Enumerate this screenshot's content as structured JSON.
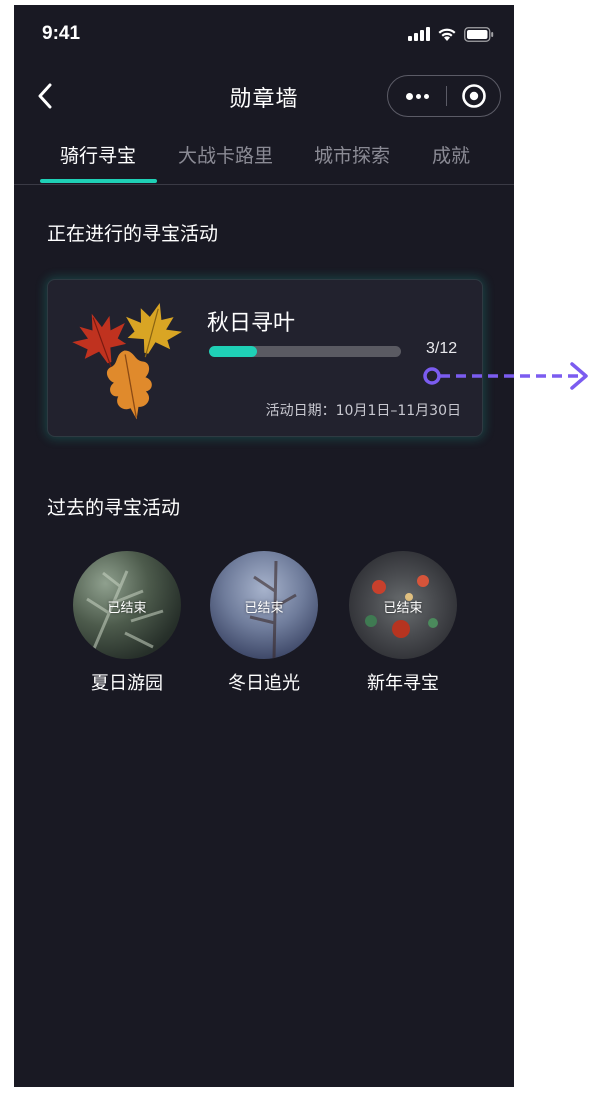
{
  "status_bar": {
    "time": "9:41"
  },
  "nav": {
    "title": "勋章墙"
  },
  "tabs": [
    {
      "label": "骑行寻宝",
      "active": true
    },
    {
      "label": "大战卡路里",
      "active": false
    },
    {
      "label": "城市探索",
      "active": false
    },
    {
      "label": "成就",
      "active": false
    }
  ],
  "current_section": {
    "title": "正在进行的寻宝活动",
    "card": {
      "title": "秋日寻叶",
      "progress_current": 3,
      "progress_total": 12,
      "progress_text": "3/12",
      "date_text": "活动日期：10月1日–11月30日"
    }
  },
  "past_section": {
    "title": "过去的寻宝活动",
    "items": [
      {
        "label": "夏日游园",
        "badge": "已结束"
      },
      {
        "label": "冬日追光",
        "badge": "已结束"
      },
      {
        "label": "新年寻宝",
        "badge": "已结束"
      }
    ]
  },
  "colors": {
    "background": "#191923",
    "accent": "#1fd0b6",
    "annotation": "#7b5cf0"
  }
}
